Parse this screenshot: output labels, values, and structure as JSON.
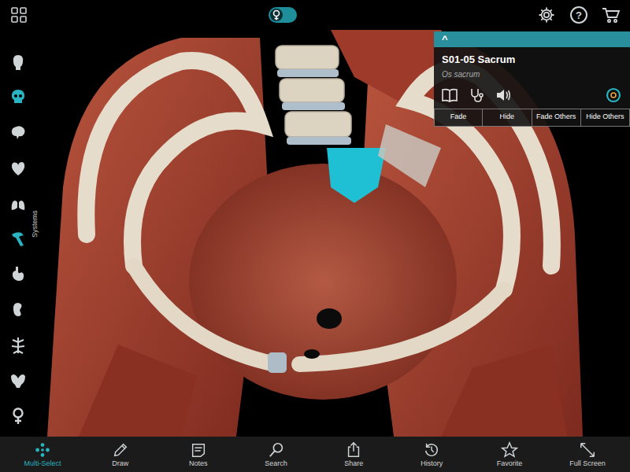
{
  "topbar": {
    "gender_toggle": {
      "on": true
    },
    "help": "?"
  },
  "sidebar": {
    "label": "Systems",
    "items": [
      {
        "selected": false
      },
      {
        "selected": true
      },
      {
        "selected": false
      },
      {
        "selected": false
      },
      {
        "selected": false
      },
      {
        "selected": true
      },
      {
        "selected": false
      },
      {
        "selected": false
      },
      {
        "selected": false
      },
      {
        "selected": false
      },
      {
        "selected": false
      }
    ]
  },
  "info_panel": {
    "collapse": "^",
    "title": "S01-05 Sacrum",
    "subtitle": "Os sacrum",
    "isolate_on": true,
    "buttons": [
      "Fade",
      "Hide",
      "Fade Others",
      "Hide Others"
    ]
  },
  "toolbar": [
    {
      "label": "Multi-Select",
      "selected": true
    },
    {
      "label": "Draw",
      "selected": false
    },
    {
      "label": "Notes",
      "selected": false
    },
    {
      "label": "Search",
      "selected": false
    },
    {
      "label": "Share",
      "selected": false
    },
    {
      "label": "History",
      "selected": false
    },
    {
      "label": "Favorite",
      "selected": false
    },
    {
      "label": "Full Screen",
      "selected": false
    }
  ]
}
